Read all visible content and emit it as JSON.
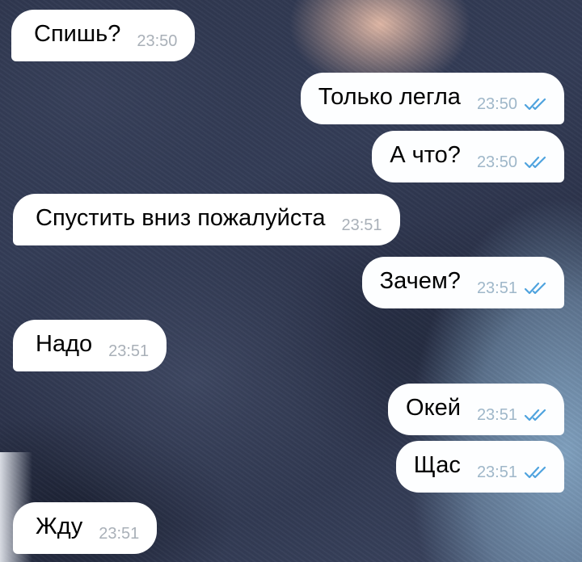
{
  "messages": [
    {
      "text": "Спишь?",
      "time": "23:50",
      "direction": "in"
    },
    {
      "text": "Только легла",
      "time": "23:50",
      "direction": "out",
      "read": true
    },
    {
      "text": "А что?",
      "time": "23:50",
      "direction": "out",
      "read": true
    },
    {
      "text": "Спустить вниз пожалуйста",
      "time": "23:51",
      "direction": "in"
    },
    {
      "text": "Зачем?",
      "time": "23:51",
      "direction": "out",
      "read": true
    },
    {
      "text": "Надо",
      "time": "23:51",
      "direction": "in"
    },
    {
      "text": "Окей",
      "time": "23:51",
      "direction": "out",
      "read": true
    },
    {
      "text": "Щас",
      "time": "23:51",
      "direction": "out",
      "read": true
    },
    {
      "text": "Жду",
      "time": "23:51",
      "direction": "in"
    }
  ],
  "colors": {
    "bubble": "#ffffff",
    "time_in": "#a9b0b8",
    "time_out": "#9fb7c9",
    "read_ticks": "#4fa3de"
  }
}
